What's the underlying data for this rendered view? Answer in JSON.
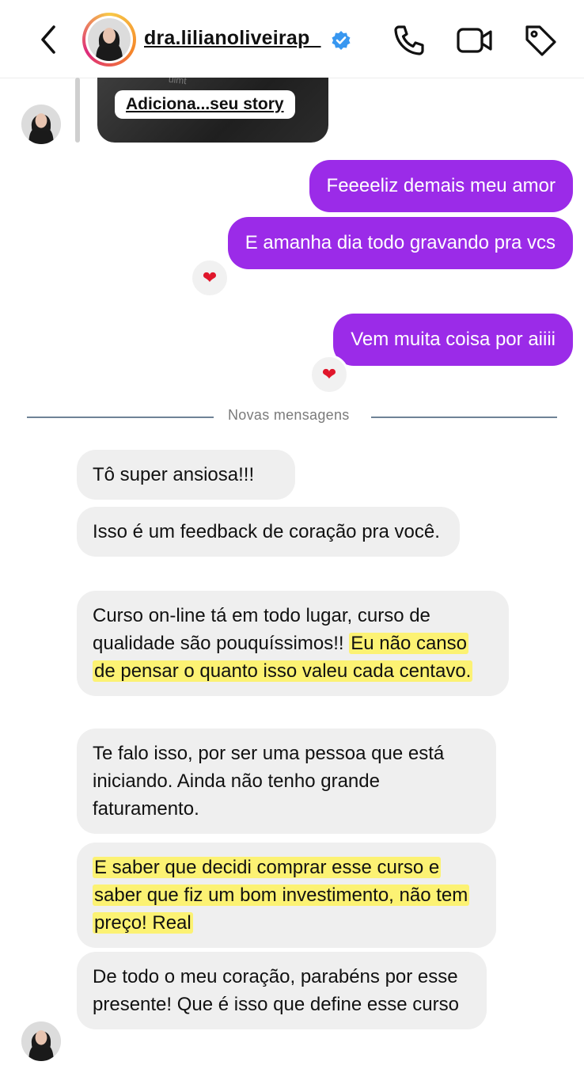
{
  "header": {
    "username": "dra.lilianoliveirap_",
    "verified": true
  },
  "story_reply": {
    "label": "Adiciona...seu story",
    "faint_text": "uimt"
  },
  "sent_messages": [
    {
      "text": "Feeeeliz demais meu amor",
      "reaction": ""
    },
    {
      "text": "E amanha dia todo gravando pra vcs",
      "reaction": "❤"
    },
    {
      "text": "Vem muita coisa por aiiii",
      "reaction": "❤"
    }
  ],
  "divider": {
    "label": "Novas mensagens"
  },
  "received_messages": [
    {
      "text": "Tô super ansiosa!!!"
    },
    {
      "text": "Isso é um feedback de coração pra você."
    },
    {
      "text_plain": "Curso on-line tá em todo lugar, curso de qualidade são pouquíssimos!! ",
      "text_highlight": "Eu não canso de pensar o quanto isso valeu cada centavo."
    },
    {
      "text": "Te falo isso, por ser uma pessoa que está iniciando. Ainda não tenho grande faturamento."
    },
    {
      "text_highlight": "E saber que decidi comprar esse curso e saber que fiz um bom investimento, não tem preço! Real"
    },
    {
      "text": "De todo o meu coração, parabéns por esse presente! Que é isso que define esse curso"
    }
  ],
  "colors": {
    "sent_bubble": "#9b2be8",
    "received_bubble": "#efefef",
    "highlight": "#fff250",
    "verified_badge": "#3897f0"
  },
  "icons": [
    "back-icon",
    "phone-icon",
    "video-icon",
    "tag-icon",
    "verified-badge-icon",
    "heart-icon"
  ]
}
